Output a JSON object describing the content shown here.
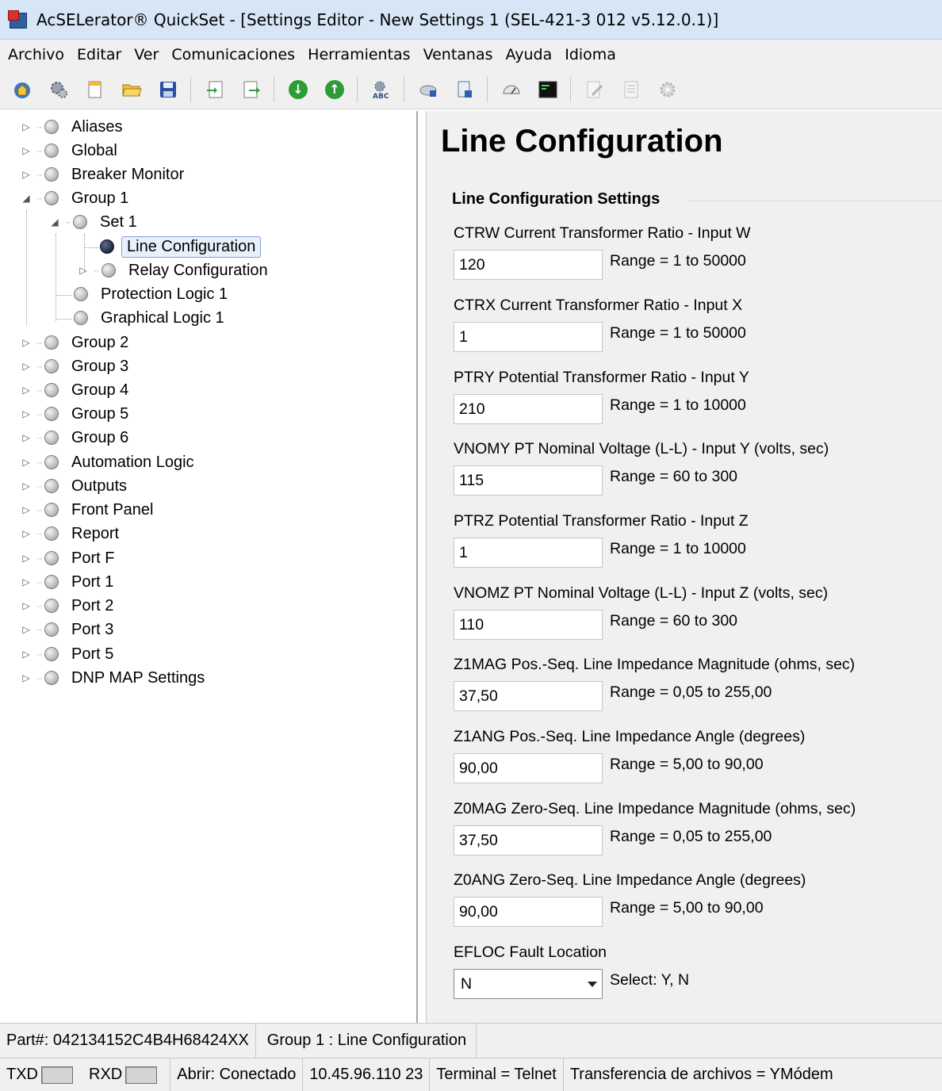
{
  "window": {
    "title": "AcSELerator® QuickSet - [Settings Editor - New Settings 1 (SEL-421-3 012 v5.12.0.1)]"
  },
  "menu": [
    "Archivo",
    "Editar",
    "Ver",
    "Comunicaciones",
    "Herramientas",
    "Ventanas",
    "Ayuda",
    "Idioma"
  ],
  "toolbar": {
    "icons": [
      "home-icon",
      "gear-icon",
      "new-file-icon",
      "open-folder-icon",
      "save-icon",
      "import-icon",
      "export-icon",
      "download-icon",
      "upload-icon",
      "abc-icon",
      "device-icon",
      "document-icon",
      "meter-icon",
      "terminal-icon",
      "edit-icon",
      "list-icon",
      "settings-icon"
    ]
  },
  "tree": {
    "items": [
      {
        "label": "Aliases"
      },
      {
        "label": "Global"
      },
      {
        "label": "Breaker Monitor"
      },
      {
        "label": "Group 1"
      },
      {
        "label": "Set 1"
      },
      {
        "label": "Line Configuration"
      },
      {
        "label": "Relay Configuration"
      },
      {
        "label": "Protection Logic 1"
      },
      {
        "label": "Graphical Logic 1"
      },
      {
        "label": "Group 2"
      },
      {
        "label": "Group 3"
      },
      {
        "label": "Group 4"
      },
      {
        "label": "Group 5"
      },
      {
        "label": "Group 6"
      },
      {
        "label": "Automation Logic"
      },
      {
        "label": "Outputs"
      },
      {
        "label": "Front Panel"
      },
      {
        "label": "Report"
      },
      {
        "label": "Port F"
      },
      {
        "label": "Port 1"
      },
      {
        "label": "Port 2"
      },
      {
        "label": "Port 3"
      },
      {
        "label": "Port 5"
      },
      {
        "label": "DNP MAP Settings"
      }
    ]
  },
  "content": {
    "title": "Line Configuration",
    "group_title": "Line Configuration Settings",
    "settings": [
      {
        "label": "CTRW  Current Transformer Ratio - Input W",
        "value": "120",
        "range": "Range = 1 to 50000"
      },
      {
        "label": "CTRX  Current Transformer Ratio - Input X",
        "value": "1",
        "range": "Range = 1 to 50000"
      },
      {
        "label": "PTRY  Potential Transformer Ratio - Input Y",
        "value": "210",
        "range": "Range = 1 to 10000"
      },
      {
        "label": "VNOMY  PT Nominal Voltage (L-L) - Input Y (volts, sec)",
        "value": "115",
        "range": "Range = 60 to 300"
      },
      {
        "label": "PTRZ  Potential Transformer Ratio - Input Z",
        "value": "1",
        "range": "Range = 1 to 10000"
      },
      {
        "label": "VNOMZ  PT Nominal Voltage (L-L) - Input Z (volts, sec)",
        "value": "110",
        "range": "Range = 60 to 300"
      },
      {
        "label": "Z1MAG  Pos.-Seq. Line Impedance Magnitude (ohms, sec)",
        "value": "37,50",
        "range": "Range = 0,05 to 255,00"
      },
      {
        "label": "Z1ANG  Pos.-Seq. Line Impedance Angle (degrees)",
        "value": "90,00",
        "range": "Range = 5,00 to 90,00"
      },
      {
        "label": "Z0MAG  Zero-Seq. Line Impedance Magnitude (ohms, sec)",
        "value": "37,50",
        "range": "Range = 0,05 to 255,00"
      },
      {
        "label": "Z0ANG  Zero-Seq. Line Impedance Angle (degrees)",
        "value": "90,00",
        "range": "Range = 5,00 to 90,00"
      }
    ],
    "efloc": {
      "label": "EFLOC  Fault Location",
      "value": "N",
      "range": "Select: Y, N"
    }
  },
  "status": {
    "part": "Part#: 042134152C4B4H68424XX",
    "location": "Group 1 : Line Configuration",
    "txd": "TXD",
    "rxd": "RXD",
    "connection": "Abrir: Conectado",
    "address": "10.45.96.110  23",
    "terminal": "Terminal = Telnet",
    "transfer": "Transferencia de archivos = YMódem"
  }
}
